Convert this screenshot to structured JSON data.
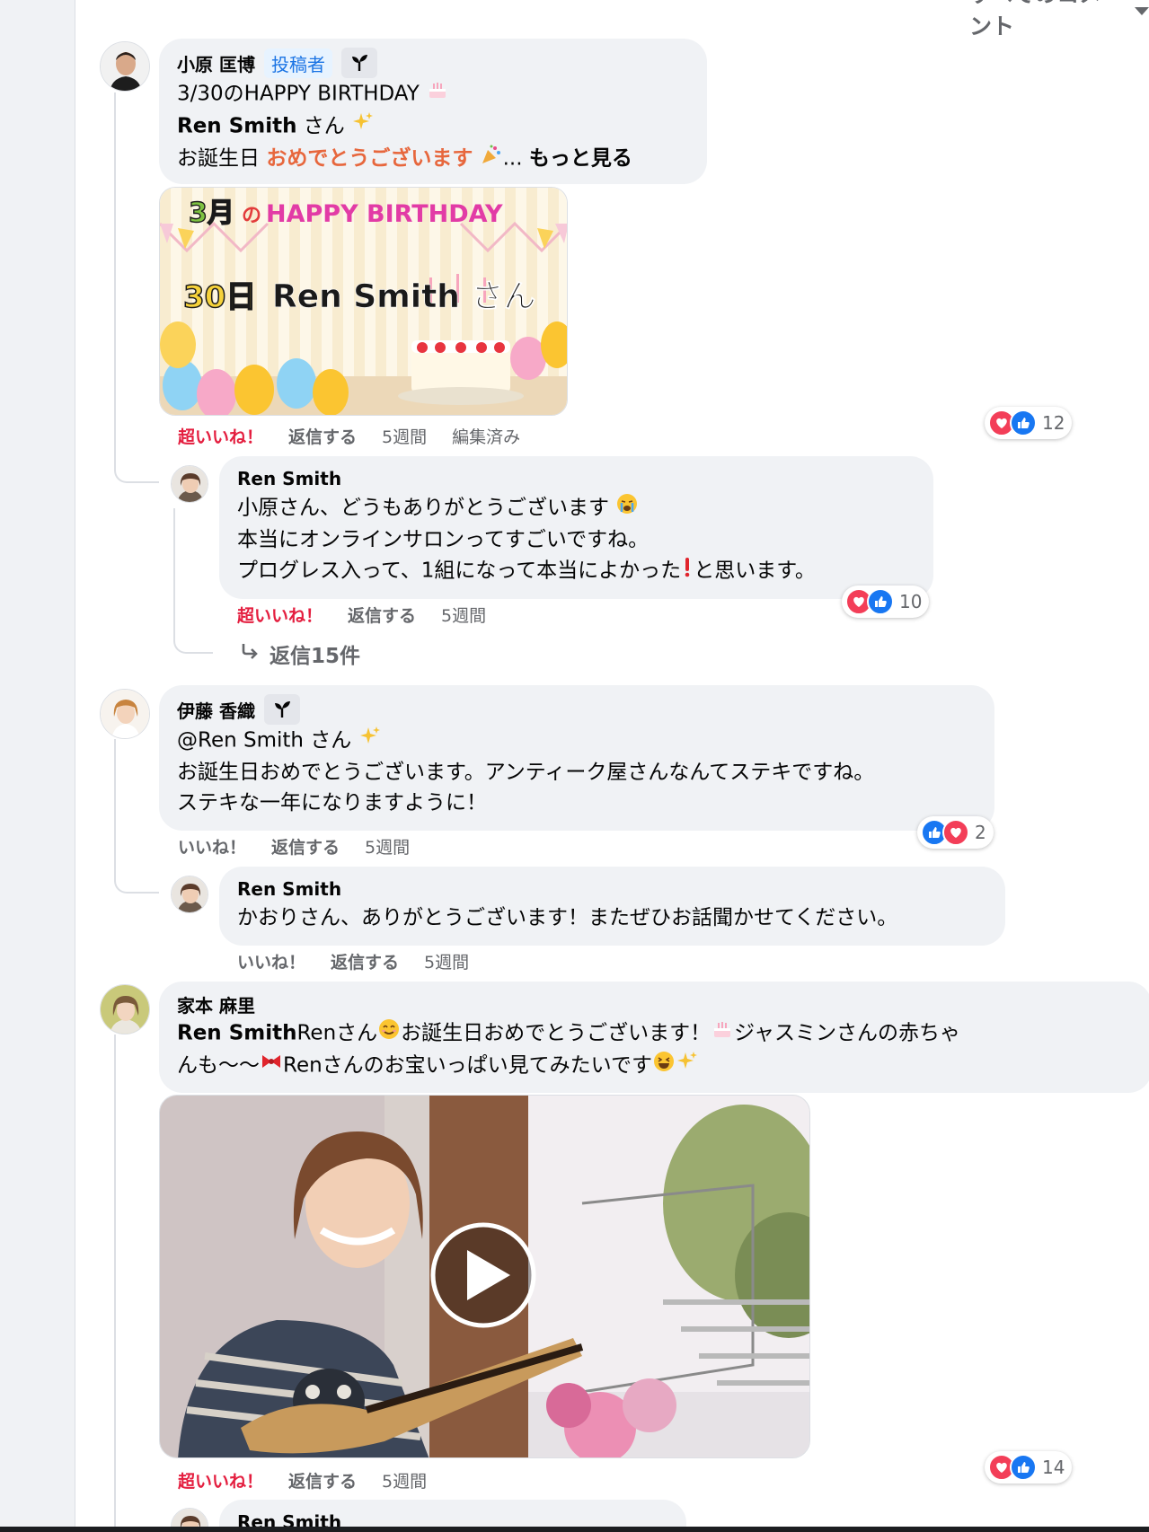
{
  "sort_label": "すべてのコメント",
  "comments": [
    {
      "author": "小原 匡博",
      "badge": "投稿者",
      "lines": {
        "l1": "3/30のHAPPY BIRTHDAY",
        "l2a": "Ren Smith",
        "l2b": " さん",
        "l3a": "お誕生日 ",
        "l3b": "おめでとうございます",
        "l3c": "...",
        "see_more": "もっと見る"
      },
      "banner": {
        "title_month": "3月",
        "title_no": "の",
        "title_happy": "HAPPY BIRTHDAY",
        "day": "30日",
        "name": "Ren Smith さん"
      },
      "actions": {
        "love": "超いいね！",
        "reply": "返信する",
        "time": "5週間",
        "edited": "編集済み"
      },
      "reaction_count": "12"
    },
    {
      "author": "Ren Smith",
      "lines": {
        "l1": "小原さん、どうもありがとうございます",
        "l2": "本当にオンラインサロンってすごいですね。",
        "l3a": "プログレス入って、1組になって本当によかった",
        "l3b": "と思います。"
      },
      "actions": {
        "love": "超いいね！",
        "reply": "返信する",
        "time": "5週間"
      },
      "reaction_count": "10",
      "more_replies": "返信15件"
    },
    {
      "author": "伊藤 香織",
      "lines": {
        "l1": "@Ren Smith さん",
        "l2": "お誕生日おめでとうございます。アンティーク屋さんなんてステキですね。",
        "l3": "ステキな一年になりますように！"
      },
      "actions": {
        "like": "いいね！",
        "reply": "返信する",
        "time": "5週間"
      },
      "reaction_count": "2"
    },
    {
      "author": "Ren Smith",
      "lines": {
        "l1": "かおりさん、ありがとうございます！またぜひお話聞かせてください。"
      },
      "actions": {
        "like": "いいね！",
        "reply": "返信する",
        "time": "5週間"
      }
    },
    {
      "author": "家本 麻里",
      "lines": {
        "l1a": "Ren Smith",
        "l1b": "Renさん",
        "l1c": "お誕生日おめでとうございます！",
        "l1d": "ジャスミンさんの赤ちゃ",
        "l2a": "んも〜〜",
        "l2b": "Renさんのお宝いっぱい見てみたいです"
      },
      "actions": {
        "love": "超いいね！",
        "reply": "返信する",
        "time": "5週間"
      },
      "reaction_count": "14"
    },
    {
      "author": "Ren Smith"
    }
  ],
  "colors": {
    "love_red": "#e41e3f",
    "like_blue": "#1877f2",
    "orange_text": "#e7673d",
    "badge_blue": "#1b74e4"
  },
  "icons": {
    "sort": "chevron-down-icon",
    "top_fan": "sprout-icon",
    "reply_arrow": "reply-arrow-icon",
    "play": "play-icon"
  }
}
